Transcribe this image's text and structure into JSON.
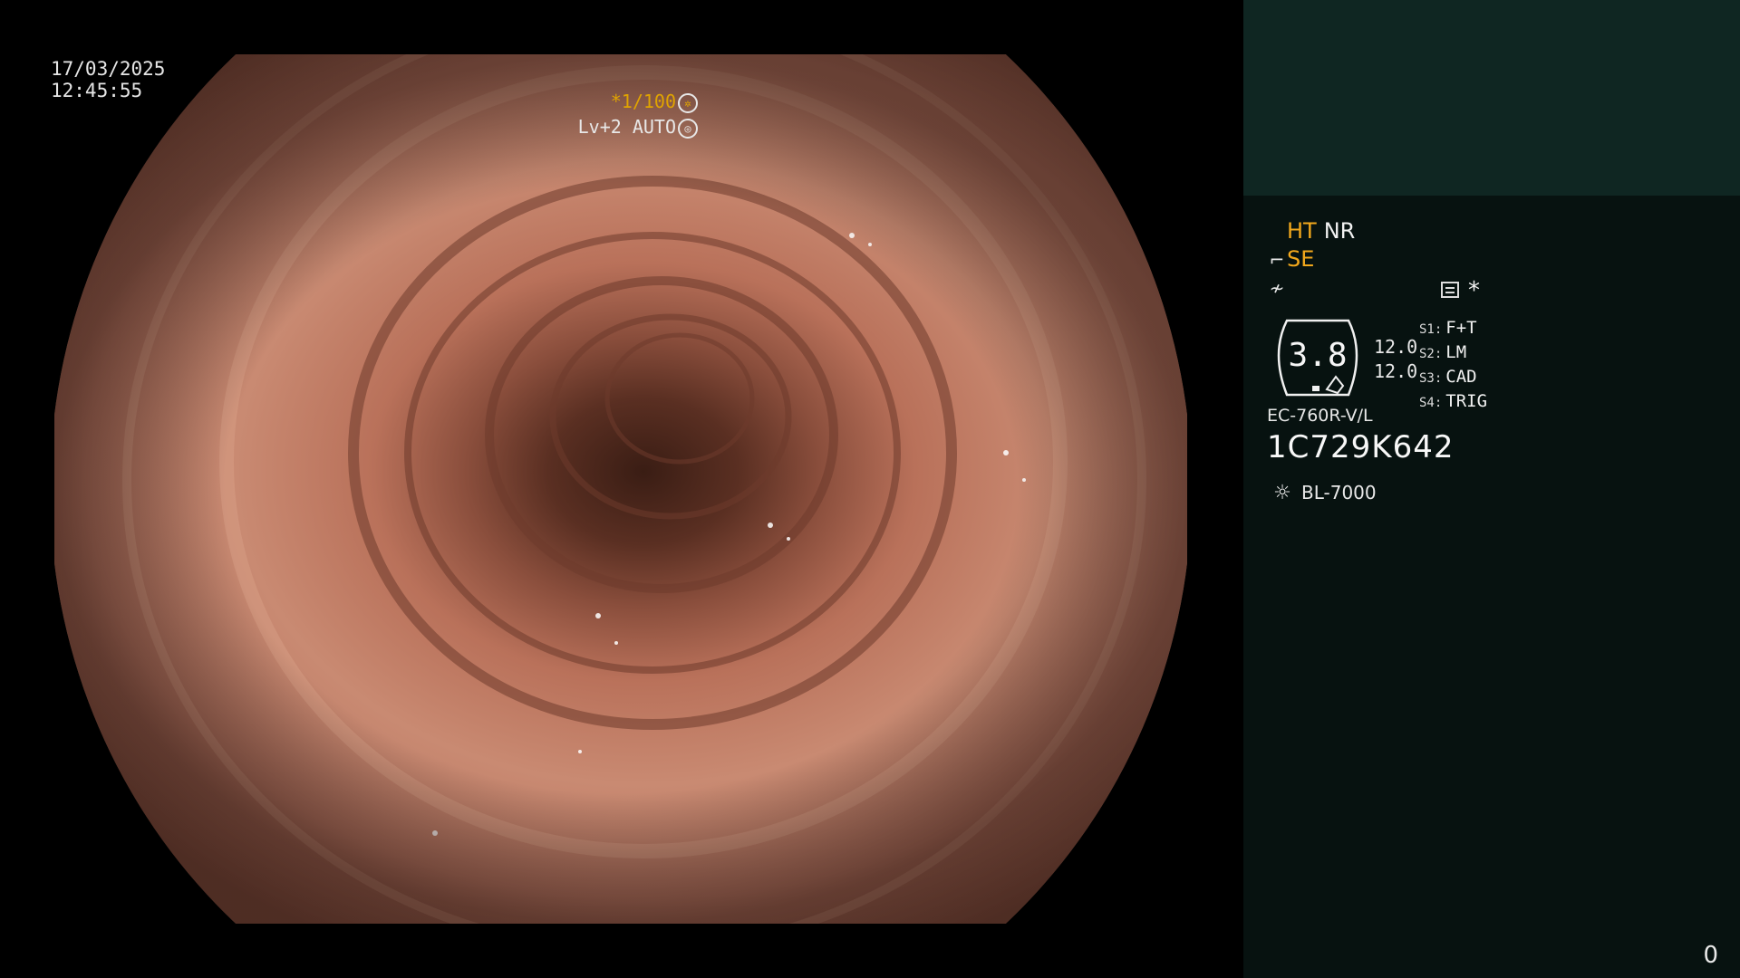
{
  "datetime": {
    "date": "17/03/2025",
    "time": "12:45:55"
  },
  "overlay": {
    "shutter": "*1/100",
    "shutter_icon": "aperture-icon",
    "level": "Lv+2 AUTO",
    "level_icon": "auto-exposure-icon"
  },
  "status": {
    "ht": "HT",
    "nr": "NR",
    "se": "SE",
    "se_icon": "scope-tip-icon",
    "mode_icon": "enhance-icon",
    "memo_icon": "memo-icon",
    "asterisk": "*"
  },
  "gauge": {
    "value": "3.8",
    "pair_top": "12.0",
    "pair_bottom": "12.0"
  },
  "switches": [
    {
      "key": "S1:",
      "value": "F+T"
    },
    {
      "key": "S2:",
      "value": "LM"
    },
    {
      "key": "S3:",
      "value": "CAD"
    },
    {
      "key": "S4:",
      "value": "TRIG"
    }
  ],
  "scope": {
    "model": "EC-760R-V/L",
    "serial": "1C729K642"
  },
  "light_source": {
    "icon": "sun-icon",
    "model": "BL-7000"
  },
  "counter": "0",
  "colors": {
    "accent": "#f2a81c",
    "panel_top": "#0f2622",
    "panel_bottom": "#071210"
  }
}
